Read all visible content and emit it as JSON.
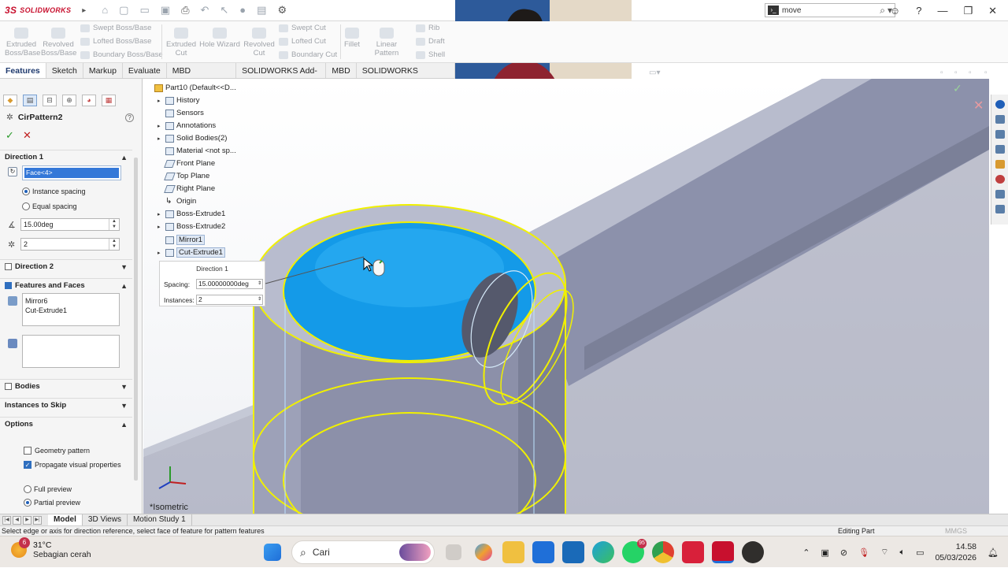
{
  "app": {
    "brand": "SOLIDWORKS",
    "search_value": "move"
  },
  "ribbon": {
    "extruded_boss": "Extruded Boss/Base",
    "revolved_boss": "Revolved Boss/Base",
    "swept_boss": "Swept Boss/Base",
    "lofted_boss": "Lofted Boss/Base",
    "boundary_boss": "Boundary Boss/Base",
    "extruded_cut": "Extruded Cut",
    "hole_wizard": "Hole Wizard",
    "revolved_cut": "Revolved Cut",
    "swept_cut": "Swept Cut",
    "lofted_cut": "Lofted Cut",
    "boundary_cut": "Boundary Cut",
    "fillet": "Fillet",
    "linear_pattern": "Linear Pattern",
    "rib": "Rib",
    "draft": "Draft",
    "shell": "Shell"
  },
  "tabs": [
    "Features",
    "Sketch",
    "Markup",
    "Evaluate",
    "MBD Dimensions",
    "SOLIDWORKS Add-Ins",
    "MBD",
    "SOLIDWORKS Inspection"
  ],
  "property_manager": {
    "title": "CirPattern2",
    "direction1_label": "Direction 1",
    "direction1_selection": "Face<4>",
    "instance_spacing": "Instance spacing",
    "equal_spacing": "Equal spacing",
    "angle_value": "15.00deg",
    "instances_value": "2",
    "direction2_label": "Direction 2",
    "features_faces_label": "Features and Faces",
    "features_list": [
      "Mirror6",
      "Cut-Extrude1"
    ],
    "bodies_label": "Bodies",
    "instances_to_skip_label": "Instances to Skip",
    "options_label": "Options",
    "geometry_pattern": "Geometry pattern",
    "propagate_visual": "Propagate visual properties",
    "full_preview": "Full preview",
    "partial_preview": "Partial preview"
  },
  "feature_tree": {
    "root": "Part10 (Default<<D...",
    "items": [
      "History",
      "Sensors",
      "Annotations",
      "Solid Bodies(2)",
      "Material <not sp...",
      "Front Plane",
      "Top Plane",
      "Right Plane",
      "Origin",
      "Boss-Extrude1",
      "Boss-Extrude2",
      "Mirror1",
      "Cut-Extrude1"
    ]
  },
  "callout": {
    "header": "Direction 1",
    "spacing_label": "Spacing:",
    "spacing_value": "15.00000000deg",
    "instances_label": "Instances:",
    "instances_value": "2"
  },
  "viewport": {
    "view_label": "*Isometric"
  },
  "bottom_tabs": [
    "Model",
    "3D Views",
    "Motion Study 1"
  ],
  "status": {
    "message": "Select edge or axis for direction reference, select face of feature for pattern features",
    "mode": "Editing Part",
    "units": "MMGS"
  },
  "taskbar": {
    "weather_badge": "6",
    "temperature": "31°C",
    "weather_text": "Sebagian cerah",
    "search_placeholder": "Cari",
    "whatsapp_badge": "95",
    "time": "14.58",
    "date": "05/03/2026"
  }
}
